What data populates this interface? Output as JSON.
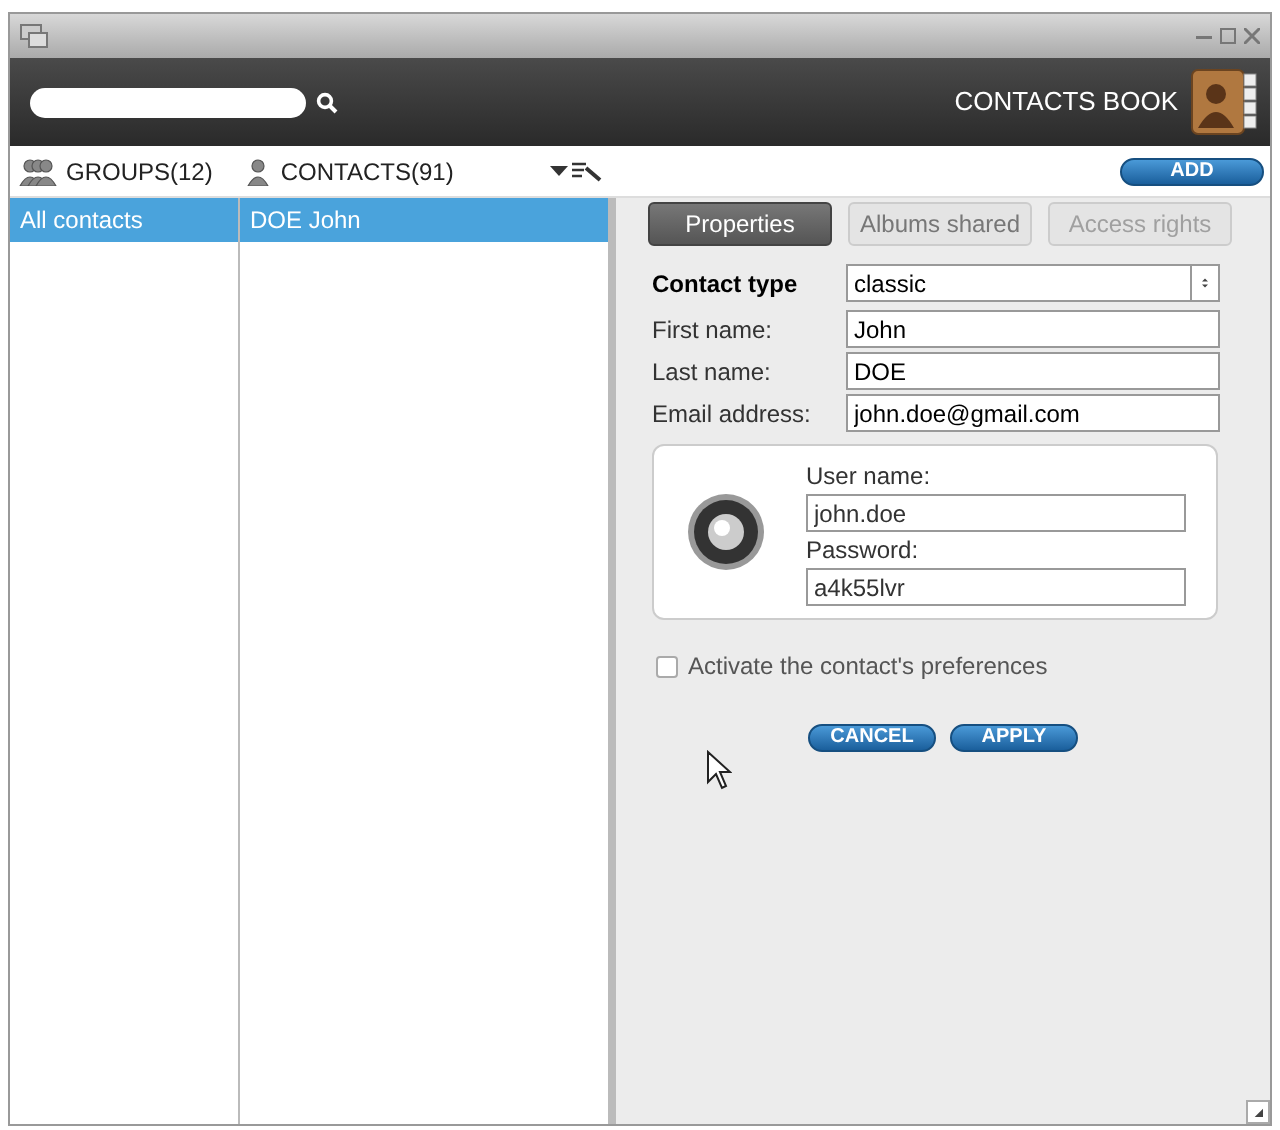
{
  "header": {
    "title": "CONTACTS BOOK"
  },
  "toolbar": {
    "groups": "GROUPS(12)",
    "contacts": "CONTACTS(91)",
    "add": "ADD"
  },
  "groups": [
    {
      "label": "All contacts",
      "selected": true
    }
  ],
  "contacts": [
    {
      "label": "DOE John",
      "selected": true
    }
  ],
  "tabs": [
    {
      "label": "Properties",
      "selected": true,
      "disabled": false
    },
    {
      "label": "Albums shared",
      "selected": false,
      "disabled": false
    },
    {
      "label": "Access rights",
      "selected": false,
      "disabled": true
    }
  ],
  "form": {
    "contact_type": {
      "label": "Contact type",
      "value": "classic"
    },
    "fields": [
      {
        "label": "First name:",
        "value": "John"
      },
      {
        "label": "Last name:",
        "value": "DOE"
      },
      {
        "label": "Email address:",
        "value": "john.doe@gmail.com"
      }
    ],
    "login": [
      {
        "label": "User name:",
        "value": "john.doe"
      },
      {
        "label": "Password:",
        "value": "a4k55lvr"
      }
    ],
    "preferences": {
      "label": "Activate the contact's preferences",
      "checked": false
    }
  },
  "buttons": [
    "CANCEL",
    "APPLY"
  ]
}
